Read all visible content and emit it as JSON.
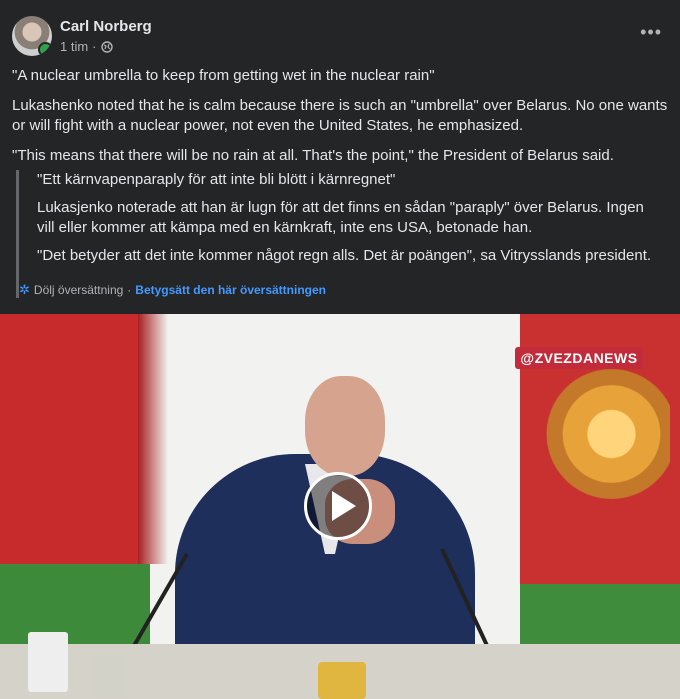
{
  "post": {
    "author": "Carl Norberg",
    "time": "1 tim",
    "separator": "·",
    "more_label": "•••",
    "paragraphs": [
      "\"A nuclear umbrella to keep from getting wet in the nuclear rain\"",
      "Lukashenko noted that he is calm because there is such an \"umbrella\" over Belarus. No one wants or will fight with a nuclear power, not even the United States, he emphasized.",
      "\"This means that there will be no rain at all. That's the point,\" the President of Belarus said."
    ]
  },
  "translation": {
    "paragraphs": [
      "\"Ett kärnvapenparaply för att inte bli blött i kärnregnet\"",
      "Lukasjenko noterade att han är lugn för att det finns en sådan \"paraply\" över Belarus. Ingen vill eller kommer att kämpa med en kärnkraft, inte ens USA, betonade han.",
      "\"Det betyder att det inte kommer något regn alls. Det är poängen\", sa Vitrysslands president."
    ],
    "hide_label": "Dölj översättning",
    "dot": "·",
    "rate_label": "Betygsätt den här översättningen"
  },
  "video": {
    "watermark": "@ZVEZDANEWS"
  },
  "colors": {
    "background": "#242526",
    "link": "#4599ff",
    "online": "#31a24c"
  },
  "icons": [
    "avatar",
    "globe-icon",
    "more-icon",
    "gear-icon",
    "play-icon"
  ]
}
